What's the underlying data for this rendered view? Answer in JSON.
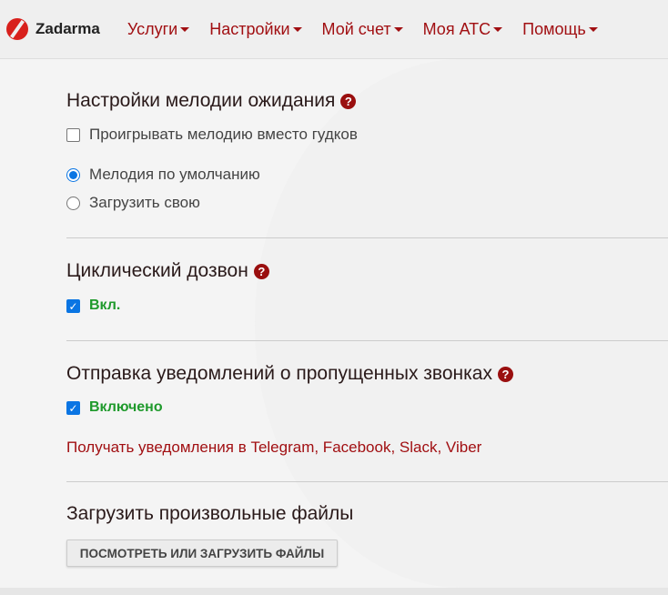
{
  "header": {
    "logo": "Zadarma",
    "nav": [
      "Услуги",
      "Настройки",
      "Мой счет",
      "Моя АТС",
      "Помощь"
    ]
  },
  "hold_music": {
    "title": "Настройки мелодии ожидания",
    "play_instead": "Проигрывать мелодию вместо гудков",
    "play_instead_checked": false,
    "default": "Мелодия по умолчанию",
    "upload": "Загрузить свою",
    "selected": "default"
  },
  "cyclic": {
    "title": "Циклический дозвон",
    "status": "Вкл.",
    "checked": true
  },
  "missed": {
    "title": "Отправка уведомлений о пропущенных звонках",
    "status": "Включено",
    "checked": true,
    "link": "Получать уведомления в Telegram, Facebook, Slack, Viber"
  },
  "files": {
    "title": "Загрузить произвольные файлы",
    "button": "ПОСМОТРЕТЬ ИЛИ ЗАГРУЗИТЬ ФАЙЛЫ"
  },
  "help_glyph": "?"
}
